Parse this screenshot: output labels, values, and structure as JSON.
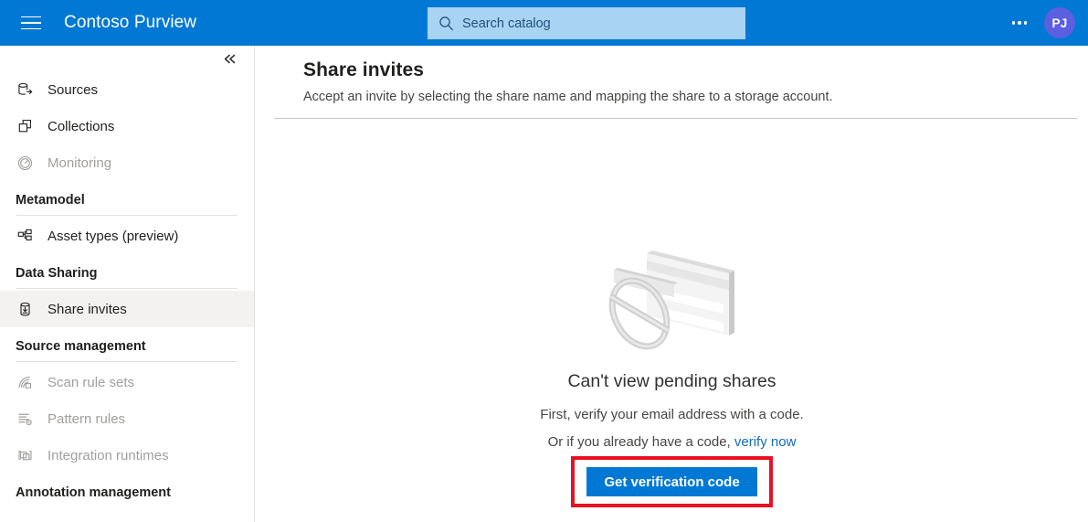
{
  "topbar": {
    "menu_icon": "hamburger-icon",
    "brand": "Contoso Purview",
    "search": {
      "icon": "search-icon",
      "placeholder": "Search catalog",
      "value": ""
    },
    "more_icon": "ellipsis-icon",
    "avatar_initials": "PJ",
    "background_color": "#0078d4",
    "search_background_color": "#a9d3f2",
    "avatar_color": "#5b5fe0"
  },
  "sidebar": {
    "collapse_label": "«",
    "collapse_icon": "chevron-double-left-icon",
    "items": [
      {
        "label": "Sources",
        "icon": "database-arrow-icon",
        "type": "item",
        "disabled": false,
        "selected": false
      },
      {
        "label": "Collections",
        "icon": "collections-icon",
        "type": "item",
        "disabled": false,
        "selected": false
      },
      {
        "label": "Monitoring",
        "icon": "gauge-icon",
        "type": "item",
        "disabled": true,
        "selected": false
      },
      {
        "label": "Metamodel",
        "icon": "",
        "type": "section",
        "disabled": false,
        "selected": false
      },
      {
        "label": "Asset types (preview)",
        "icon": "asset-types-icon",
        "type": "item",
        "disabled": false,
        "selected": false
      },
      {
        "label": "Data Sharing",
        "icon": "",
        "type": "section",
        "disabled": false,
        "selected": false
      },
      {
        "label": "Share invites",
        "icon": "share-invites-icon",
        "type": "item",
        "disabled": false,
        "selected": true
      },
      {
        "label": "Source management",
        "icon": "",
        "type": "section",
        "disabled": false,
        "selected": false
      },
      {
        "label": "Scan rule sets",
        "icon": "scan-rule-sets-icon",
        "type": "item",
        "disabled": true,
        "selected": false
      },
      {
        "label": "Pattern rules",
        "icon": "pattern-rules-icon",
        "type": "item",
        "disabled": true,
        "selected": false
      },
      {
        "label": "Integration runtimes",
        "icon": "integration-runtimes-icon",
        "type": "item",
        "disabled": true,
        "selected": false
      },
      {
        "label": "Annotation management",
        "icon": "",
        "type": "section",
        "disabled": false,
        "selected": false
      }
    ],
    "selected_background_color": "#f3f2f1"
  },
  "main": {
    "title": "Share invites",
    "subtitle": "Accept an invite by selecting the share name and mapping the share to a storage account.",
    "empty_state": {
      "illustration": "blocked-card-illustration",
      "title": "Can't view pending shares",
      "line1": "First, verify your email address with a code.",
      "line2_prefix": "Or if you already have a code, ",
      "line2_link": "verify now",
      "cta_label": "Get verification code",
      "cta_color": "#0078d4",
      "highlight_color": "#e81123"
    }
  }
}
